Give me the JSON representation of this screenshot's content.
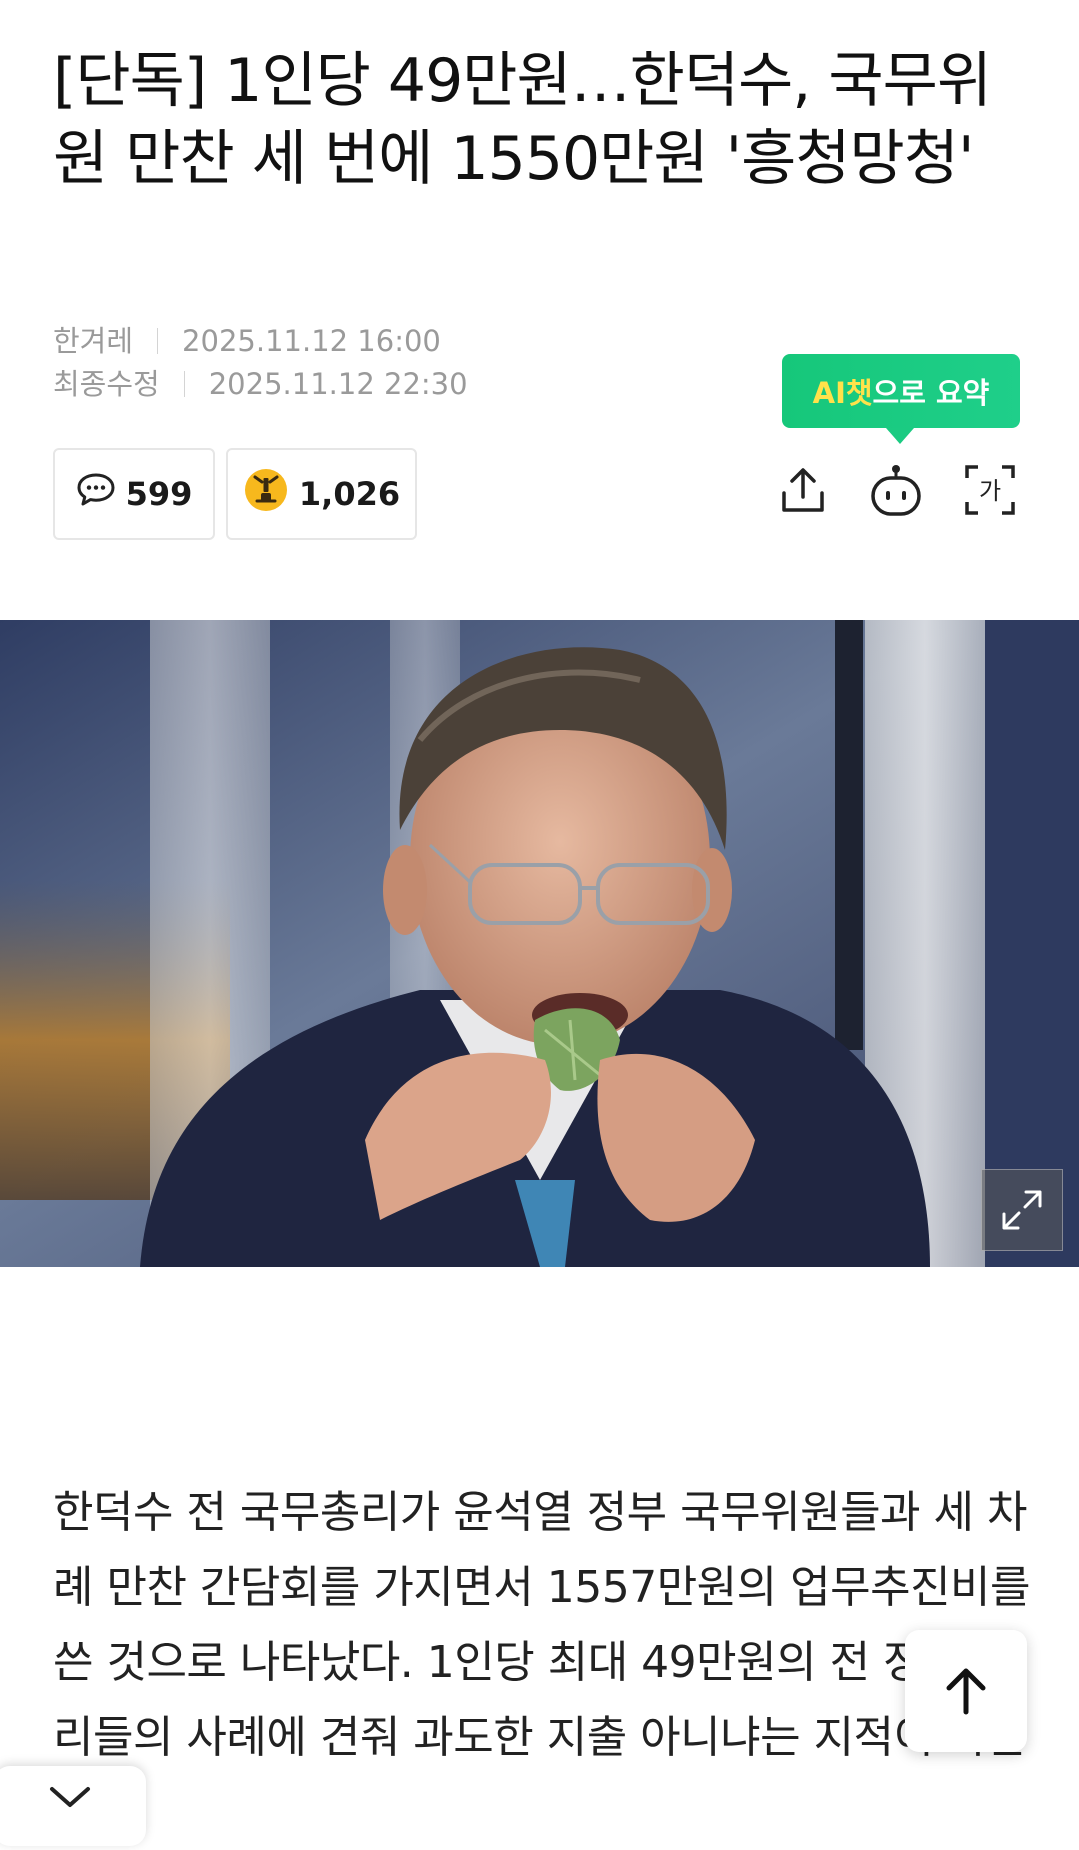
{
  "article": {
    "headline": "[단독] 1인당 49만원…한덕수, 국무위원 만찬 세 번에 1550만원 '흥청망청'",
    "source": "한겨레",
    "published": "2025.11.12 16:00",
    "modified_label": "최종수정",
    "modified": "2025.11.12 22:30",
    "body": "한덕수 전 국무총리가 윤석열 정부 국무위원들과 세 차례 만찬 간담회를 가지면서 1557만원의 업무추진비를 쓴 것으로 나타났다. 1인당 최대 49만원의 전 정부 총리들의 사례에 견줘 과도한 지출 아니냐는 지적이 나온다."
  },
  "ai_summary": {
    "highlight": "AI챗",
    "rest": "으로 요약"
  },
  "stats": {
    "comments": "599",
    "reactions": "1,026"
  },
  "icons": {
    "comment": "speech-bubble-icon",
    "reaction": "angry-face-icon",
    "share": "share-icon",
    "bot": "ai-bot-icon",
    "font": "font-size-icon",
    "expand": "expand-icon",
    "top": "arrow-up-icon",
    "collapse": "chevron-down-icon"
  },
  "colors": {
    "accent_green": "#16c77a",
    "reaction_yellow": "#f7b81d"
  }
}
